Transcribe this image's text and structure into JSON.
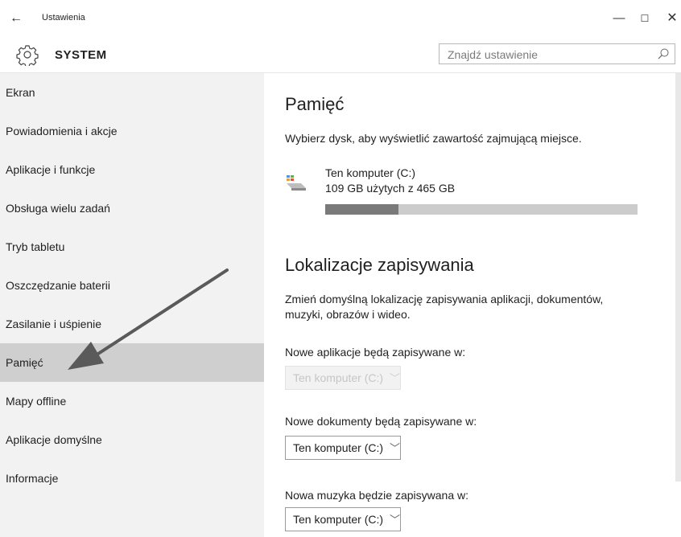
{
  "window": {
    "back": "←",
    "title": "Ustawienia",
    "minimize": "—",
    "maximize": "☐",
    "close": "✕"
  },
  "header": {
    "icon": "gear-icon",
    "title": "SYSTEM",
    "search_placeholder": "Znajdź ustawienie",
    "search_icon": "search-icon"
  },
  "sidebar": {
    "items": [
      {
        "label": "Ekran"
      },
      {
        "label": "Powiadomienia i akcje"
      },
      {
        "label": "Aplikacje i funkcje"
      },
      {
        "label": "Obsługa wielu zadań"
      },
      {
        "label": "Tryb tabletu"
      },
      {
        "label": "Oszczędzanie baterii"
      },
      {
        "label": "Zasilanie i uśpienie"
      },
      {
        "label": "Pamięć"
      },
      {
        "label": "Mapy offline"
      },
      {
        "label": "Aplikacje domyślne"
      },
      {
        "label": "Informacje"
      }
    ],
    "selected_index": 7,
    "selected_color": "#cfcfcf",
    "background": "#f2f2f2"
  },
  "main": {
    "storage_title": "Pamięć",
    "storage_desc": "Wybierz dysk, aby wyświetlić zawartość zajmującą miejsce.",
    "drive": {
      "icon": "drive-icon",
      "name": "Ten komputer (C:)",
      "usage": "109 GB użytych z 465 GB",
      "used_fraction": 0.234
    },
    "save_title": "Lokalizacje zapisywania",
    "save_desc": "Zmień domyślną lokalizację zapisywania aplikacji, dokumentów, muzyki, obrazów i wideo.",
    "apps_label": "Nowe aplikacje będą zapisywane w:",
    "apps_value": "Ten komputer (C:)",
    "docs_label": "Nowe dokumenty będą zapisywane w:",
    "docs_value": "Ten komputer (C:)",
    "music_label": "Nowa muzyka będzie zapisywana w:",
    "music_value": "Ten komputer (C:)"
  }
}
